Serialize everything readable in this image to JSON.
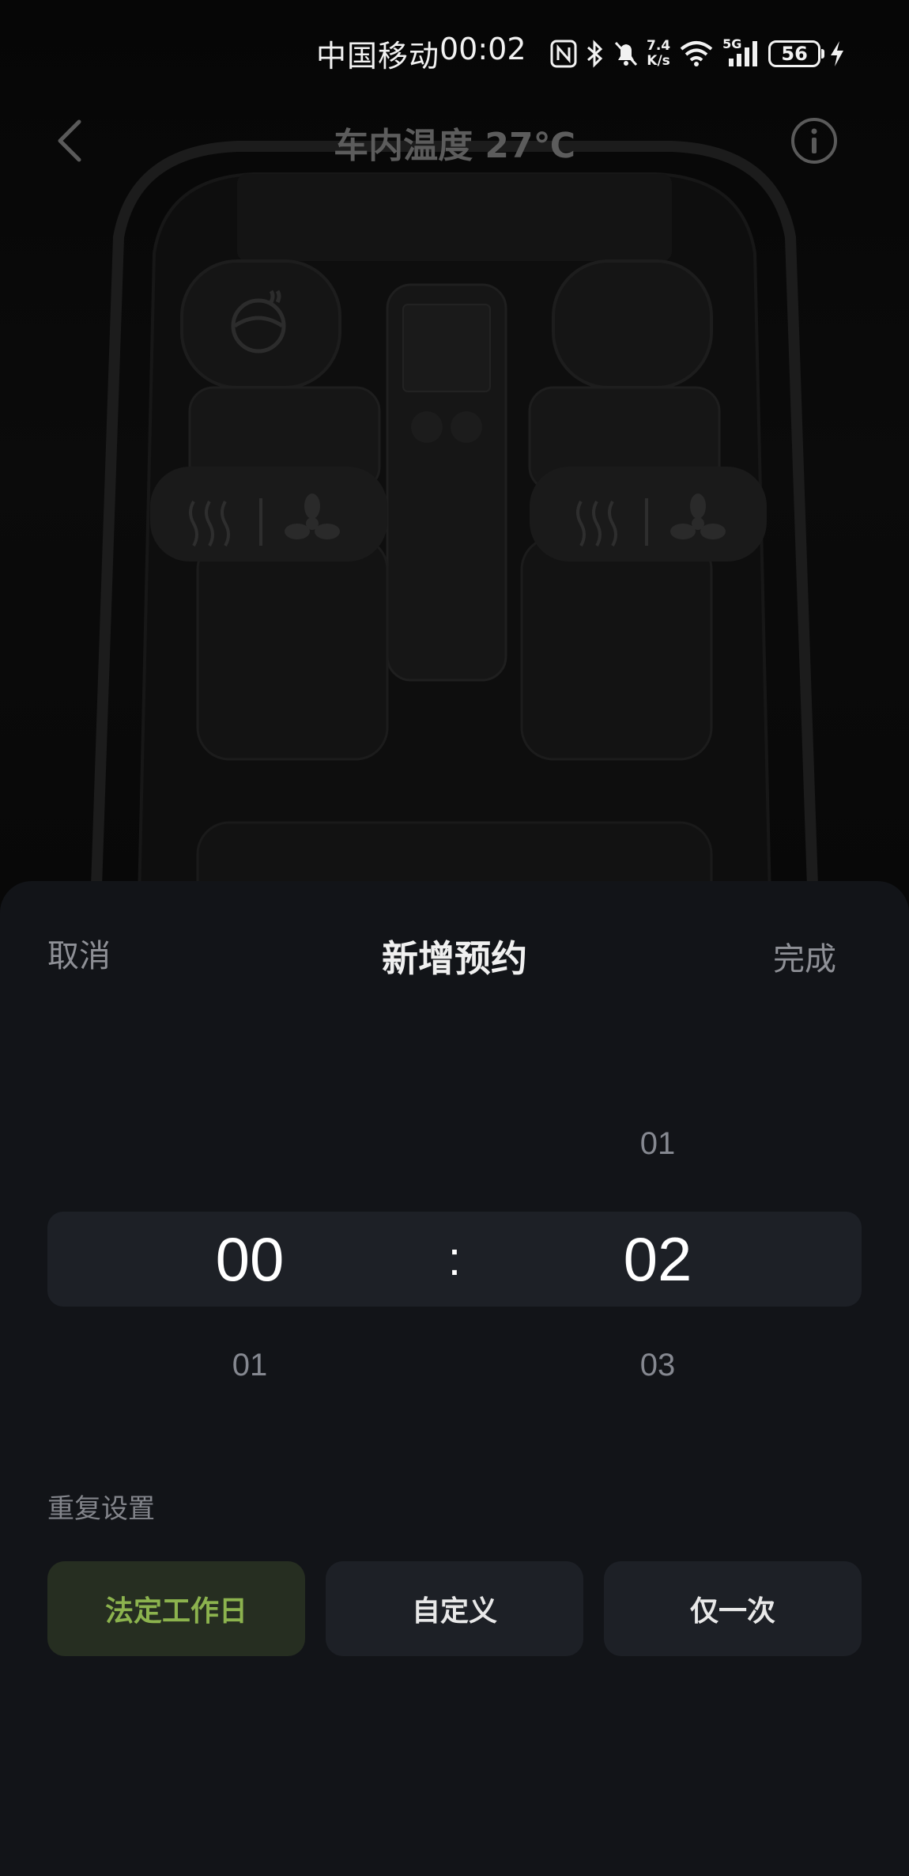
{
  "status_bar": {
    "carrier": "中国移动",
    "time": "00:02",
    "net_speed_value": "7.4",
    "net_speed_unit": "K/s",
    "signal_type": "5G",
    "battery_level": "56",
    "icons": [
      "nfc-icon",
      "bluetooth-icon",
      "mute-bell-icon",
      "net-speed-indicator",
      "wifi-icon",
      "cell-signal-icon",
      "battery-icon",
      "charging-bolt-icon"
    ]
  },
  "nav": {
    "title": "车内温度 27℃",
    "back_icon": "chevron-left-icon",
    "info_icon": "info-circle-icon"
  },
  "sheet": {
    "cancel_label": "取消",
    "title": "新增预约",
    "done_label": "完成"
  },
  "time_picker": {
    "hour": {
      "prev": "",
      "selected": "00",
      "next": "01"
    },
    "separator": ":",
    "minute": {
      "prev": "01",
      "selected": "02",
      "next": "03"
    }
  },
  "repeat": {
    "label": "重复设置",
    "options": [
      {
        "label": "法定工作日",
        "selected": true
      },
      {
        "label": "自定义",
        "selected": false
      },
      {
        "label": "仅一次",
        "selected": false
      }
    ]
  },
  "colors": {
    "sheet_bg": "#121418",
    "band_bg": "#1d2026",
    "accent_green": "#8cb34e",
    "active_bg": "#262e21",
    "muted_text": "#8e9096"
  }
}
